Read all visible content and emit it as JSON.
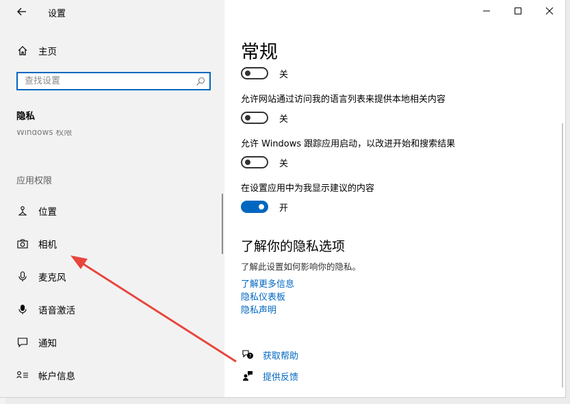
{
  "window": {
    "title": "设置"
  },
  "sidebar": {
    "home_label": "主页",
    "search_placeholder": "查找设置",
    "section_title": "隐私",
    "cut_off_item": "Windows 权限",
    "group_header": "应用权限",
    "items": [
      {
        "label": "位置",
        "icon": "location-icon"
      },
      {
        "label": "相机",
        "icon": "camera-icon"
      },
      {
        "label": "麦克风",
        "icon": "microphone-icon"
      },
      {
        "label": "语音激活",
        "icon": "voice-activation-icon"
      },
      {
        "label": "通知",
        "icon": "notification-icon"
      },
      {
        "label": "帐户信息",
        "icon": "account-info-icon"
      }
    ]
  },
  "main": {
    "page_title": "常规",
    "settings": [
      {
        "description": "",
        "state": "关",
        "on": false
      },
      {
        "description": "允许网站通过访问我的语言列表来提供本地相关内容",
        "state": "关",
        "on": false
      },
      {
        "description": "允许 Windows 跟踪应用启动，以改进开始和搜索结果",
        "state": "关",
        "on": false
      },
      {
        "description": "在设置应用中为我显示建议的内容",
        "state": "开",
        "on": true
      }
    ],
    "privacy_section": {
      "heading": "了解你的隐私选项",
      "description": "了解此设置如何影响你的隐私。",
      "links": [
        "了解更多信息",
        "隐私仪表板",
        "隐私声明"
      ]
    },
    "help": {
      "get_help": "获取帮助",
      "give_feedback": "提供反馈"
    }
  },
  "colors": {
    "accent": "#0067c0",
    "annotation_arrow": "#e8453c",
    "sidebar_bg": "#f2f2f2"
  }
}
